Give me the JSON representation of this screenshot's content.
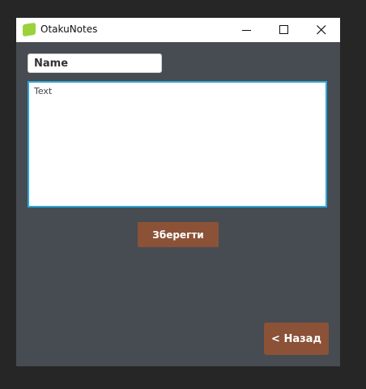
{
  "window": {
    "title": "OtakuNotes",
    "icon": "app-logo-icon",
    "controls": {
      "minimize_icon": "minimize-icon",
      "maximize_icon": "maximize-icon",
      "close_icon": "close-icon"
    }
  },
  "form": {
    "name_value": "Name",
    "text_value": "Text",
    "save_label": "Зберегти",
    "back_label": "< Назад"
  },
  "colors": {
    "background": "#474c52",
    "button": "#8b5237",
    "focus_border": "#2ea7d8",
    "app_icon": "#9bd23c"
  }
}
